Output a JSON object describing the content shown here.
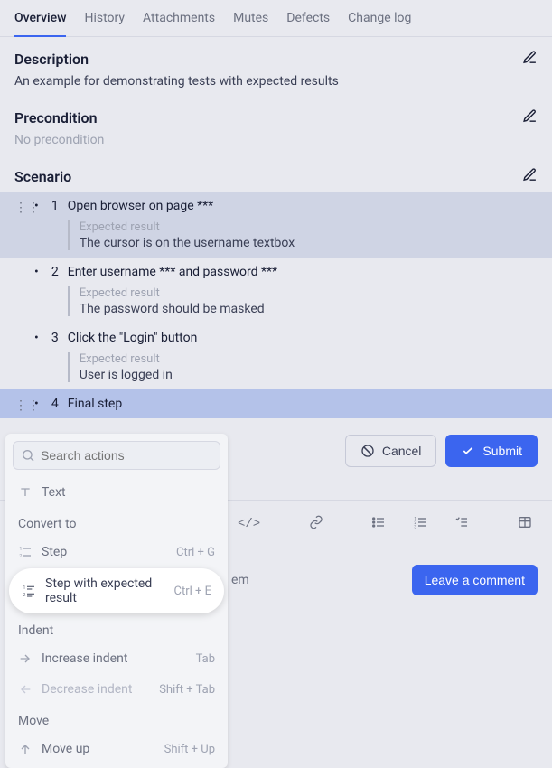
{
  "tabs": {
    "overview": "Overview",
    "history": "History",
    "attachments": "Attachments",
    "mutes": "Mutes",
    "defects": "Defects",
    "changelog": "Change log"
  },
  "description": {
    "title": "Description",
    "body": "An example for demonstrating tests with expected results"
  },
  "precondition": {
    "title": "Precondition",
    "body": "No precondition"
  },
  "scenario": {
    "title": "Scenario",
    "expected_label": "Expected result",
    "steps": [
      {
        "num": "1",
        "text": "Open browser on page ***",
        "expected": "The cursor is on the username textbox"
      },
      {
        "num": "2",
        "text": "Enter username *** and password ***",
        "expected": "The password should be masked"
      },
      {
        "num": "3",
        "text": "Click the \"Login\" button",
        "expected": "User is logged in"
      },
      {
        "num": "4",
        "text": "Final step",
        "expected": null
      }
    ]
  },
  "actions": {
    "cancel": "Cancel",
    "submit": "Submit"
  },
  "comment": {
    "tail": "em",
    "button": "Leave a comment"
  },
  "menu": {
    "search_placeholder": "Search actions",
    "text": "Text",
    "group_convert": "Convert to",
    "step": {
      "label": "Step",
      "shortcut": "Ctrl + G"
    },
    "step_exp": {
      "label": "Step with expected result",
      "shortcut": "Ctrl + E"
    },
    "group_indent": "Indent",
    "inc": {
      "label": "Increase indent",
      "shortcut": "Tab"
    },
    "dec": {
      "label": "Decrease indent",
      "shortcut": "Shift + Tab"
    },
    "group_move": "Move",
    "moveup": {
      "label": "Move up",
      "shortcut": "Shift + Up"
    }
  }
}
